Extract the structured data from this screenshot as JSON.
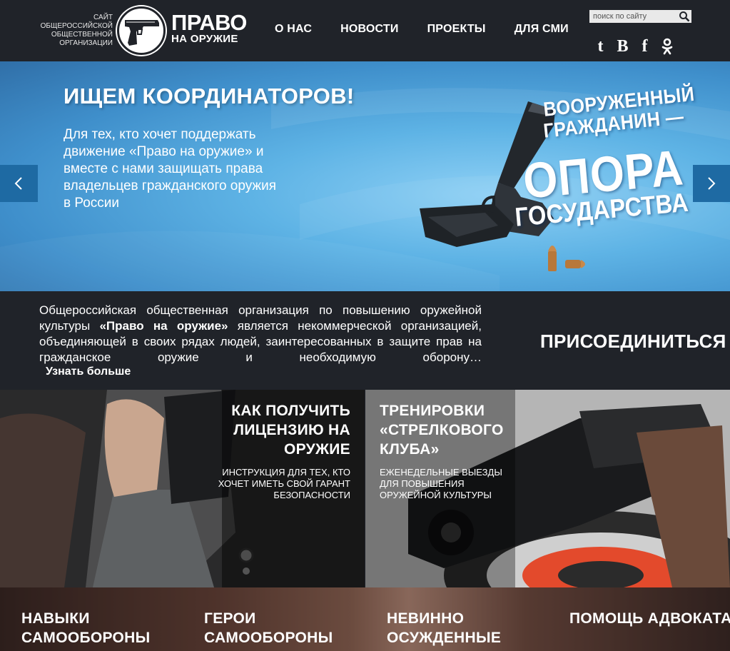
{
  "header": {
    "site_caption": [
      "Сайт",
      "общероссийской",
      "общественной",
      "организации"
    ],
    "logo_line1": "ПРАВО",
    "logo_line2": "НА ОРУЖИЕ",
    "nav": [
      "О НАС",
      "НОВОСТИ",
      "ПРОЕКТЫ",
      "ДЛЯ СМИ"
    ],
    "search_placeholder": "поиск по сайту",
    "social": [
      "tumblr-icon",
      "vk-icon",
      "facebook-icon",
      "odnoklassniki-icon"
    ]
  },
  "hero": {
    "title": "ИЩЕМ КООРДИНАТОРОВ!",
    "text": "Для тех, кто хочет поддержать движение «Право на оружие» и вместе с нами защищать права владельцев гражданского оружия в России",
    "poster": [
      "ВООРУЖЕННЫЙ",
      "ГРАЖДАНИН —",
      "ОПОРА",
      "ГОСУДАРСТВА"
    ]
  },
  "about": {
    "text_before": "Общероссийская общественная организация по повышению оружейной культуры ",
    "text_bold": "«Право на оружие»",
    "text_after": " является некоммерческой организацией, объединяющей в своих рядах людей, заинтересованных в защите прав на гражданское оружие и необходимую оборону…",
    "more": "Узнать больше",
    "join": "ПРИСОЕДИНИТЬСЯ"
  },
  "tiles": [
    {
      "title": "КАК ПОЛУЧИТЬ ЛИЦЕНЗИЮ НА ОРУЖИЕ",
      "sub": "ИНСТРУКЦИЯ ДЛЯ ТЕХ, КТО ХОЧЕТ ИМЕТЬ СВОЙ ГАРАНТ БЕЗОПАСНОСТИ"
    },
    {
      "title": "ТРЕНИРОВКИ «СТРЕЛКОВОГО КЛУБА»",
      "sub": "ЕЖЕНЕДЕЛЬНЫЕ ВЫЕЗДЫ ДЛЯ ПОВЫШЕНИЯ ОРУЖЕЙНОЙ КУЛЬТУРЫ"
    }
  ],
  "bottom": [
    "НАВЫКИ САМООБОРОНЫ",
    "ГЕРОИ САМООБОРОНЫ",
    "НЕВИННО ОСУЖДЕННЫЕ",
    "ПОМОЩЬ АДВОКАТА"
  ],
  "colors": {
    "header_bg": "#202329",
    "hero_blue": "#4a9fd6",
    "arrow_bg": "#1e6aa3"
  }
}
